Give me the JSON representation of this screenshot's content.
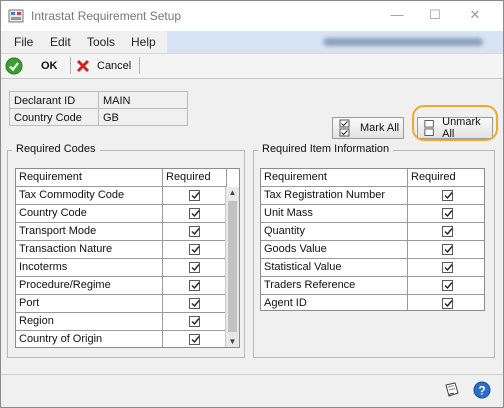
{
  "window": {
    "title": "Intrastat Requirement Setup",
    "minimize_glyph": "—",
    "maximize_glyph": "☐",
    "close_glyph": "✕"
  },
  "menu": {
    "items": [
      "File",
      "Edit",
      "Tools",
      "Help"
    ]
  },
  "toolbar": {
    "ok_label": "OK",
    "cancel_label": "Cancel"
  },
  "fields": {
    "declarant_id_label": "Declarant ID",
    "declarant_id_value": "MAIN",
    "country_code_label": "Country Code",
    "country_code_value": "GB"
  },
  "buttons": {
    "mark_all": "Mark All",
    "unmark_all": "Unmark All"
  },
  "required_codes": {
    "group_title": "Required Codes",
    "col_requirement": "Requirement",
    "col_required": "Required",
    "rows": [
      {
        "requirement": "Tax Commodity Code",
        "required": true
      },
      {
        "requirement": "Country Code",
        "required": true
      },
      {
        "requirement": "Transport Mode",
        "required": true
      },
      {
        "requirement": "Transaction Nature",
        "required": true
      },
      {
        "requirement": "Incoterms",
        "required": true
      },
      {
        "requirement": "Procedure/Regime",
        "required": true
      },
      {
        "requirement": "Port",
        "required": true
      },
      {
        "requirement": "Region",
        "required": true
      },
      {
        "requirement": "Country of Origin",
        "required": true
      }
    ]
  },
  "required_items": {
    "group_title": "Required Item Information",
    "col_requirement": "Requirement",
    "col_required": "Required",
    "rows": [
      {
        "requirement": "Tax Registration Number",
        "required": true
      },
      {
        "requirement": "Unit Mass",
        "required": true
      },
      {
        "requirement": "Quantity",
        "required": true
      },
      {
        "requirement": "Goods Value",
        "required": true
      },
      {
        "requirement": "Statistical Value",
        "required": true
      },
      {
        "requirement": "Traders Reference",
        "required": true
      },
      {
        "requirement": "Agent ID",
        "required": true
      }
    ]
  },
  "icons": {
    "app": "app-icon",
    "ok": "green-check-icon",
    "cancel": "red-x-icon",
    "note": "note-icon",
    "help": "help-icon"
  },
  "colors": {
    "ok_green": "#3aa030",
    "cancel_red": "#cc2222",
    "highlight_orange": "#f0a830",
    "menu_blue": "#d7e4f5"
  }
}
